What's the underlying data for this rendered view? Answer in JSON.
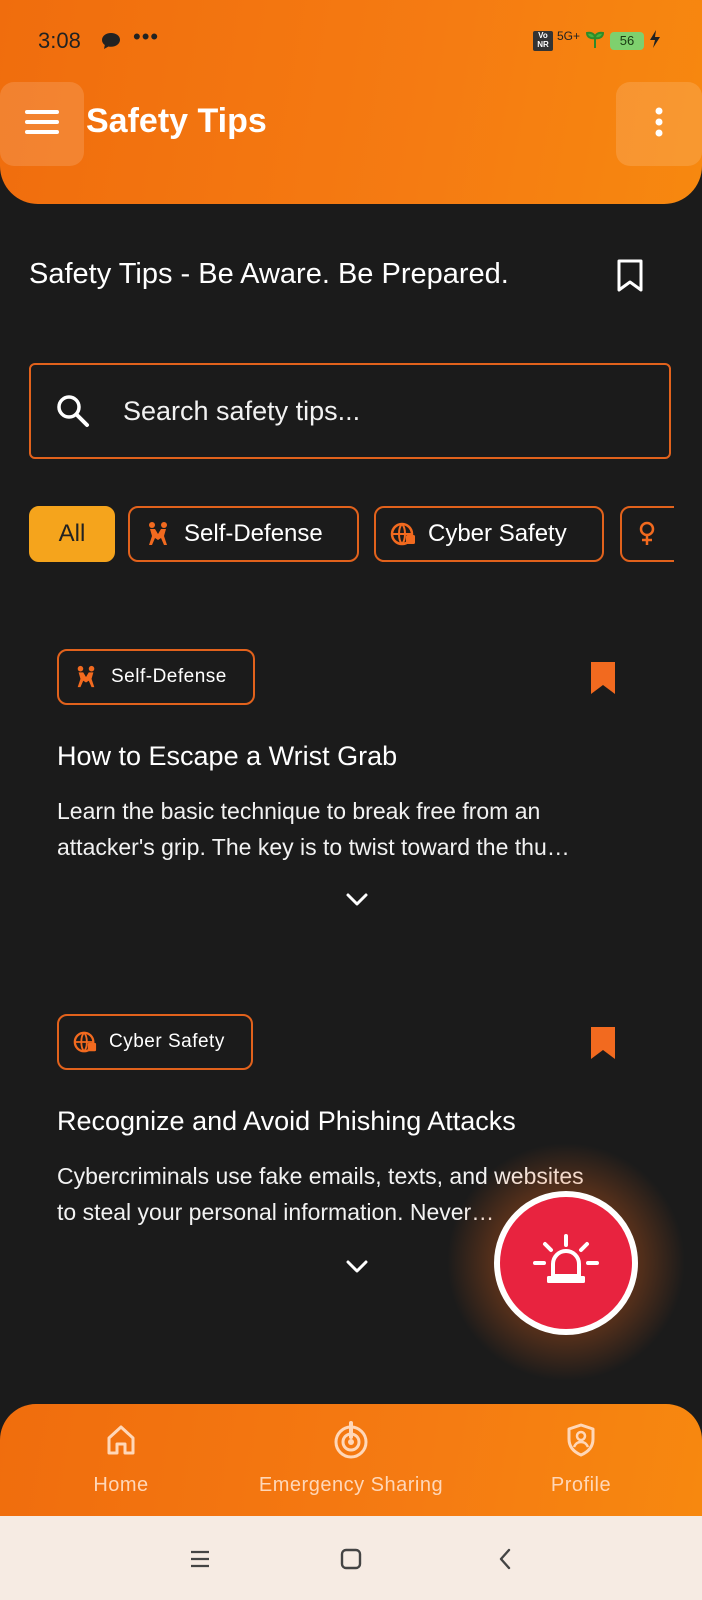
{
  "status_bar": {
    "time": "3:08",
    "dots": "•••",
    "volte": "Vo\nNR",
    "network": "5G+",
    "battery": "56"
  },
  "header": {
    "title": "Safety Tips",
    "menu_icon": "hamburger-icon",
    "more_icon": "more-vertical-icon"
  },
  "page": {
    "heading": "Safety Tips - Be Aware. Be Prepared.",
    "bookmark_icon": "bookmark-outline-icon"
  },
  "search": {
    "placeholder": "Search safety tips...",
    "value": ""
  },
  "filters": [
    {
      "label": "All",
      "selected": true
    },
    {
      "label": "Self-Defense",
      "icon": "self-defense-icon"
    },
    {
      "label": "Cyber Safety",
      "icon": "cyber-safety-icon"
    },
    {
      "label": "",
      "icon": "female-icon"
    }
  ],
  "cards": [
    {
      "category": "Self-Defense",
      "category_icon": "self-defense-icon",
      "title": "How to Escape a Wrist Grab",
      "body_line1": "Learn the basic technique to break free from an",
      "body_line2": "attacker's grip. The key is to twist toward the thu…",
      "bookmarked": true
    },
    {
      "category": "Cyber Safety",
      "category_icon": "cyber-safety-icon",
      "title": "Recognize and Avoid Phishing Attacks",
      "body_line1": "Cybercriminals use fake emails, texts, and websites",
      "body_line2": "to steal your personal information. Never…",
      "bookmarked": true
    }
  ],
  "fab": {
    "icon": "siren-icon"
  },
  "bottom_nav": [
    {
      "label": "Home",
      "icon": "home-icon"
    },
    {
      "label": "Emergency Sharing",
      "icon": "emergency-sharing-icon"
    },
    {
      "label": "Profile",
      "icon": "profile-shield-icon"
    }
  ],
  "colors": {
    "accent": "#f57b12",
    "background": "#1b1b1b",
    "chip_selected": "#f5a41c",
    "sos": "#e8233f",
    "border": "#e2621c"
  }
}
